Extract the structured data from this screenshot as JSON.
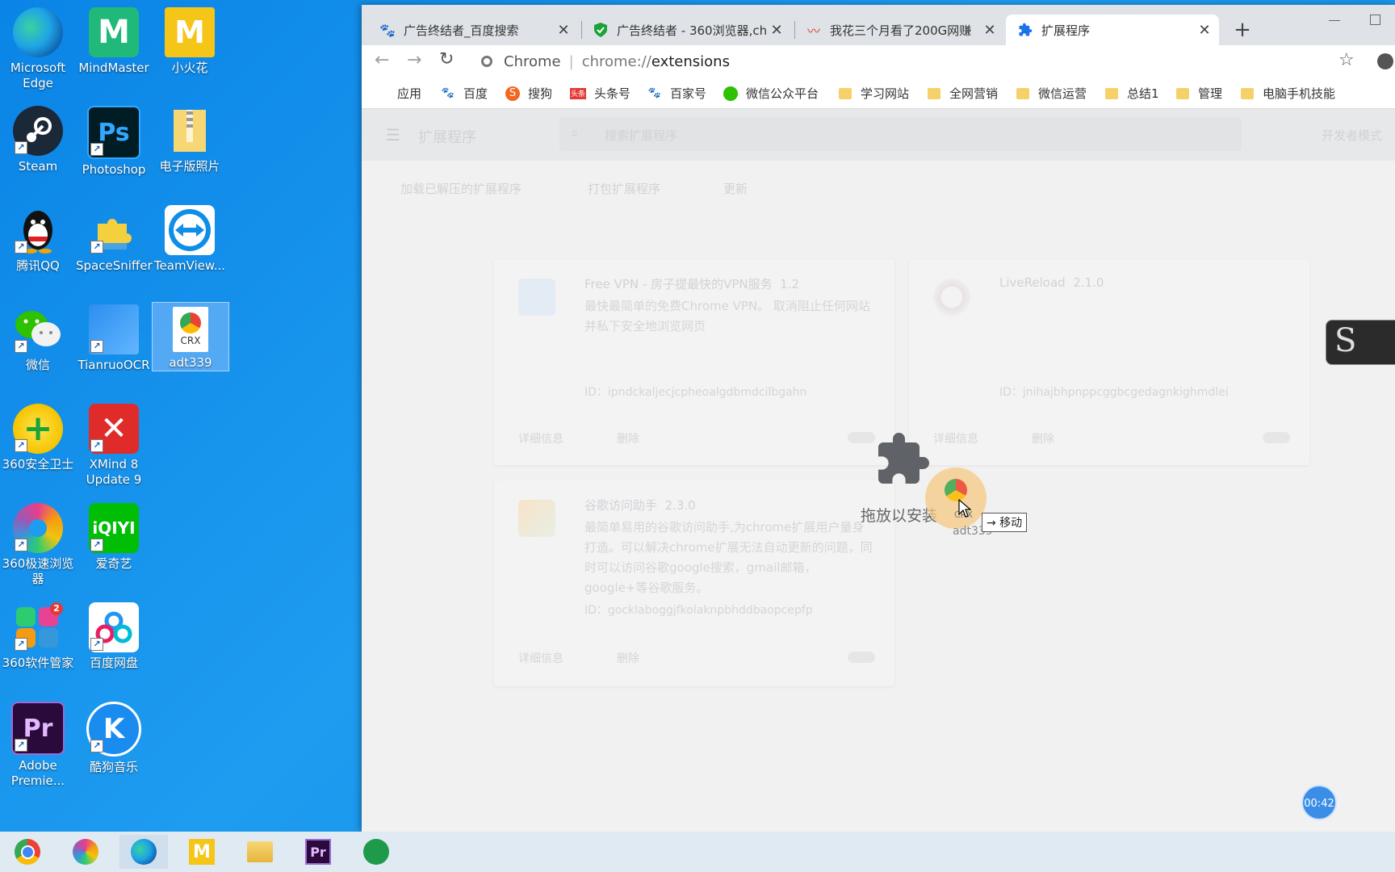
{
  "desktop": {
    "icons": [
      {
        "label": "Microsoft Edge"
      },
      {
        "label": "MindMaster"
      },
      {
        "label": "小火花"
      },
      {
        "label": "Steam"
      },
      {
        "label": "Photoshop"
      },
      {
        "label": "电子版照片"
      },
      {
        "label": "腾讯QQ"
      },
      {
        "label": "SpaceSniffer"
      },
      {
        "label": "TeamView..."
      },
      {
        "label": "微信"
      },
      {
        "label": "TianruoOCR"
      },
      {
        "label": "adt339"
      },
      {
        "label": "360安全卫士"
      },
      {
        "label": "XMind 8 Update 9"
      },
      {
        "label": "360极速浏览器"
      },
      {
        "label": "爱奇艺"
      },
      {
        "label": "360软件管家"
      },
      {
        "label": "百度网盘"
      },
      {
        "label": "Adobe Premie..."
      },
      {
        "label": "酷狗音乐"
      }
    ],
    "badge": "2",
    "crx_text": "CRX"
  },
  "browser": {
    "tabs": [
      {
        "title": "广告终结者_百度搜索"
      },
      {
        "title": "广告终结者 - 360浏览器,ch"
      },
      {
        "title": "我花三个月看了200G网赚"
      },
      {
        "title": "扩展程序"
      }
    ],
    "new_tab": "+",
    "close_glyph": "✕",
    "address": {
      "scheme_label": "Chrome",
      "url_prefix": "chrome://",
      "url_path": "extensions"
    },
    "bookmarks": [
      {
        "label": "应用"
      },
      {
        "label": "百度"
      },
      {
        "label": "搜狗"
      },
      {
        "label": "头条号"
      },
      {
        "label": "百家号"
      },
      {
        "label": "微信公众平台"
      },
      {
        "label": "学习网站"
      },
      {
        "label": "全网营销"
      },
      {
        "label": "微信运营"
      },
      {
        "label": "总结1"
      },
      {
        "label": "管理"
      },
      {
        "label": "电脑手机技能"
      }
    ]
  },
  "extensions_page": {
    "title": "扩展程序",
    "search_placeholder": "搜索扩展程序",
    "dev_mode_label": "开发者模式",
    "actions": [
      "加载已解压的扩展程序",
      "打包扩展程序",
      "更新"
    ],
    "cards": [
      {
        "name": "Free VPN - 房子提最快的VPN服务",
        "version": "1.2",
        "desc": "最快最简单的免费Chrome VPN。 取消阻止任何网站并私下安全地浏览网页",
        "id": "ID：ipndckaljecjcpheoalgdbmdcilbgahn",
        "details": "详细信息",
        "remove": "删除"
      },
      {
        "name": "LiveReload",
        "version": "2.1.0",
        "desc": "",
        "id": "ID：jnihajbhpnppcggbcgedagnkighmdlei",
        "details": "详细信息",
        "remove": "删除"
      },
      {
        "name": "谷歌访问助手",
        "version": "2.3.0",
        "desc": "最简单易用的谷歌访问助手,为chrome扩展用户量身打造。可以解决chrome扩展无法自动更新的问题，同时可以访问谷歌google搜索，gmail邮箱，google+等谷歌服务。",
        "id": "ID：gocklaboggjfkolaknpbhddbaopcepfp",
        "details": "详细信息",
        "remove": "删除"
      }
    ],
    "drop_hint": "拖放以安装",
    "drag_tooltip": "→ 移动",
    "drag_file_label": "adt339"
  },
  "overlay": {
    "timer": "00:42"
  },
  "colors": {
    "desktop_bg": "#0e88e0",
    "accent": "#1a73e8",
    "timer_bg": "#3b8ee6"
  }
}
